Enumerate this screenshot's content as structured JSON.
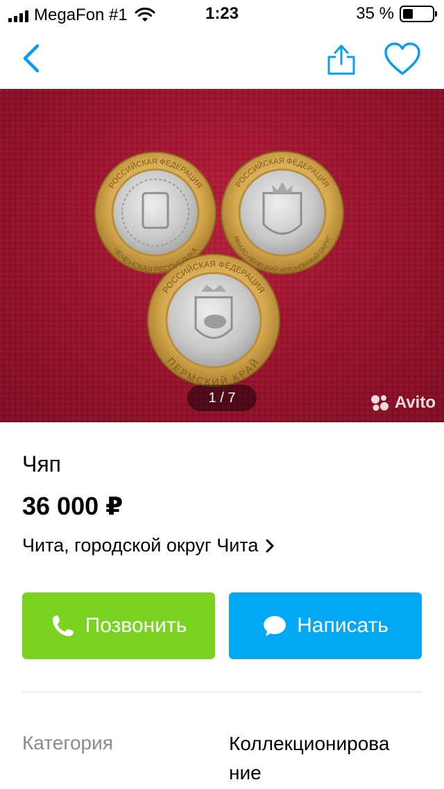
{
  "status_bar": {
    "carrier": "MegaFon #1",
    "time": "1:23",
    "battery": "35 %",
    "battery_level": 0.35
  },
  "nav": {
    "back_icon": "chevron-left-icon",
    "share_icon": "share-icon",
    "favorite_icon": "heart-icon",
    "accent_color": "#0a9cf0"
  },
  "gallery": {
    "counter": "1 / 7",
    "watermark": "Avito",
    "coins": [
      {
        "top_text": "РОССИЙСКАЯ ФЕДЕРАЦИЯ",
        "bottom_text": "ЧЕЧЕНСКАЯ РЕСПУБЛИКА"
      },
      {
        "top_text": "РОССИЙСКАЯ ФЕДЕРАЦИЯ",
        "bottom_text": "ЯМАЛО-НЕНЕЦКИЙ АВТОНОМНЫЙ ОКРУГ"
      },
      {
        "top_text": "РОССИЙСКАЯ ФЕДЕРАЦИЯ",
        "bottom_text": "ПЕРМСКИЙ КРАЙ"
      }
    ]
  },
  "listing": {
    "title": "Чяп",
    "price": "36 000 ₽",
    "location": "Чита, городской округ Чита"
  },
  "actions": {
    "call_label": "Позвонить",
    "call_color": "#7ad321",
    "write_label": "Написать",
    "write_color": "#02a8f4"
  },
  "params": {
    "category_label": "Категория",
    "category_value": "Коллекционирова ние"
  }
}
